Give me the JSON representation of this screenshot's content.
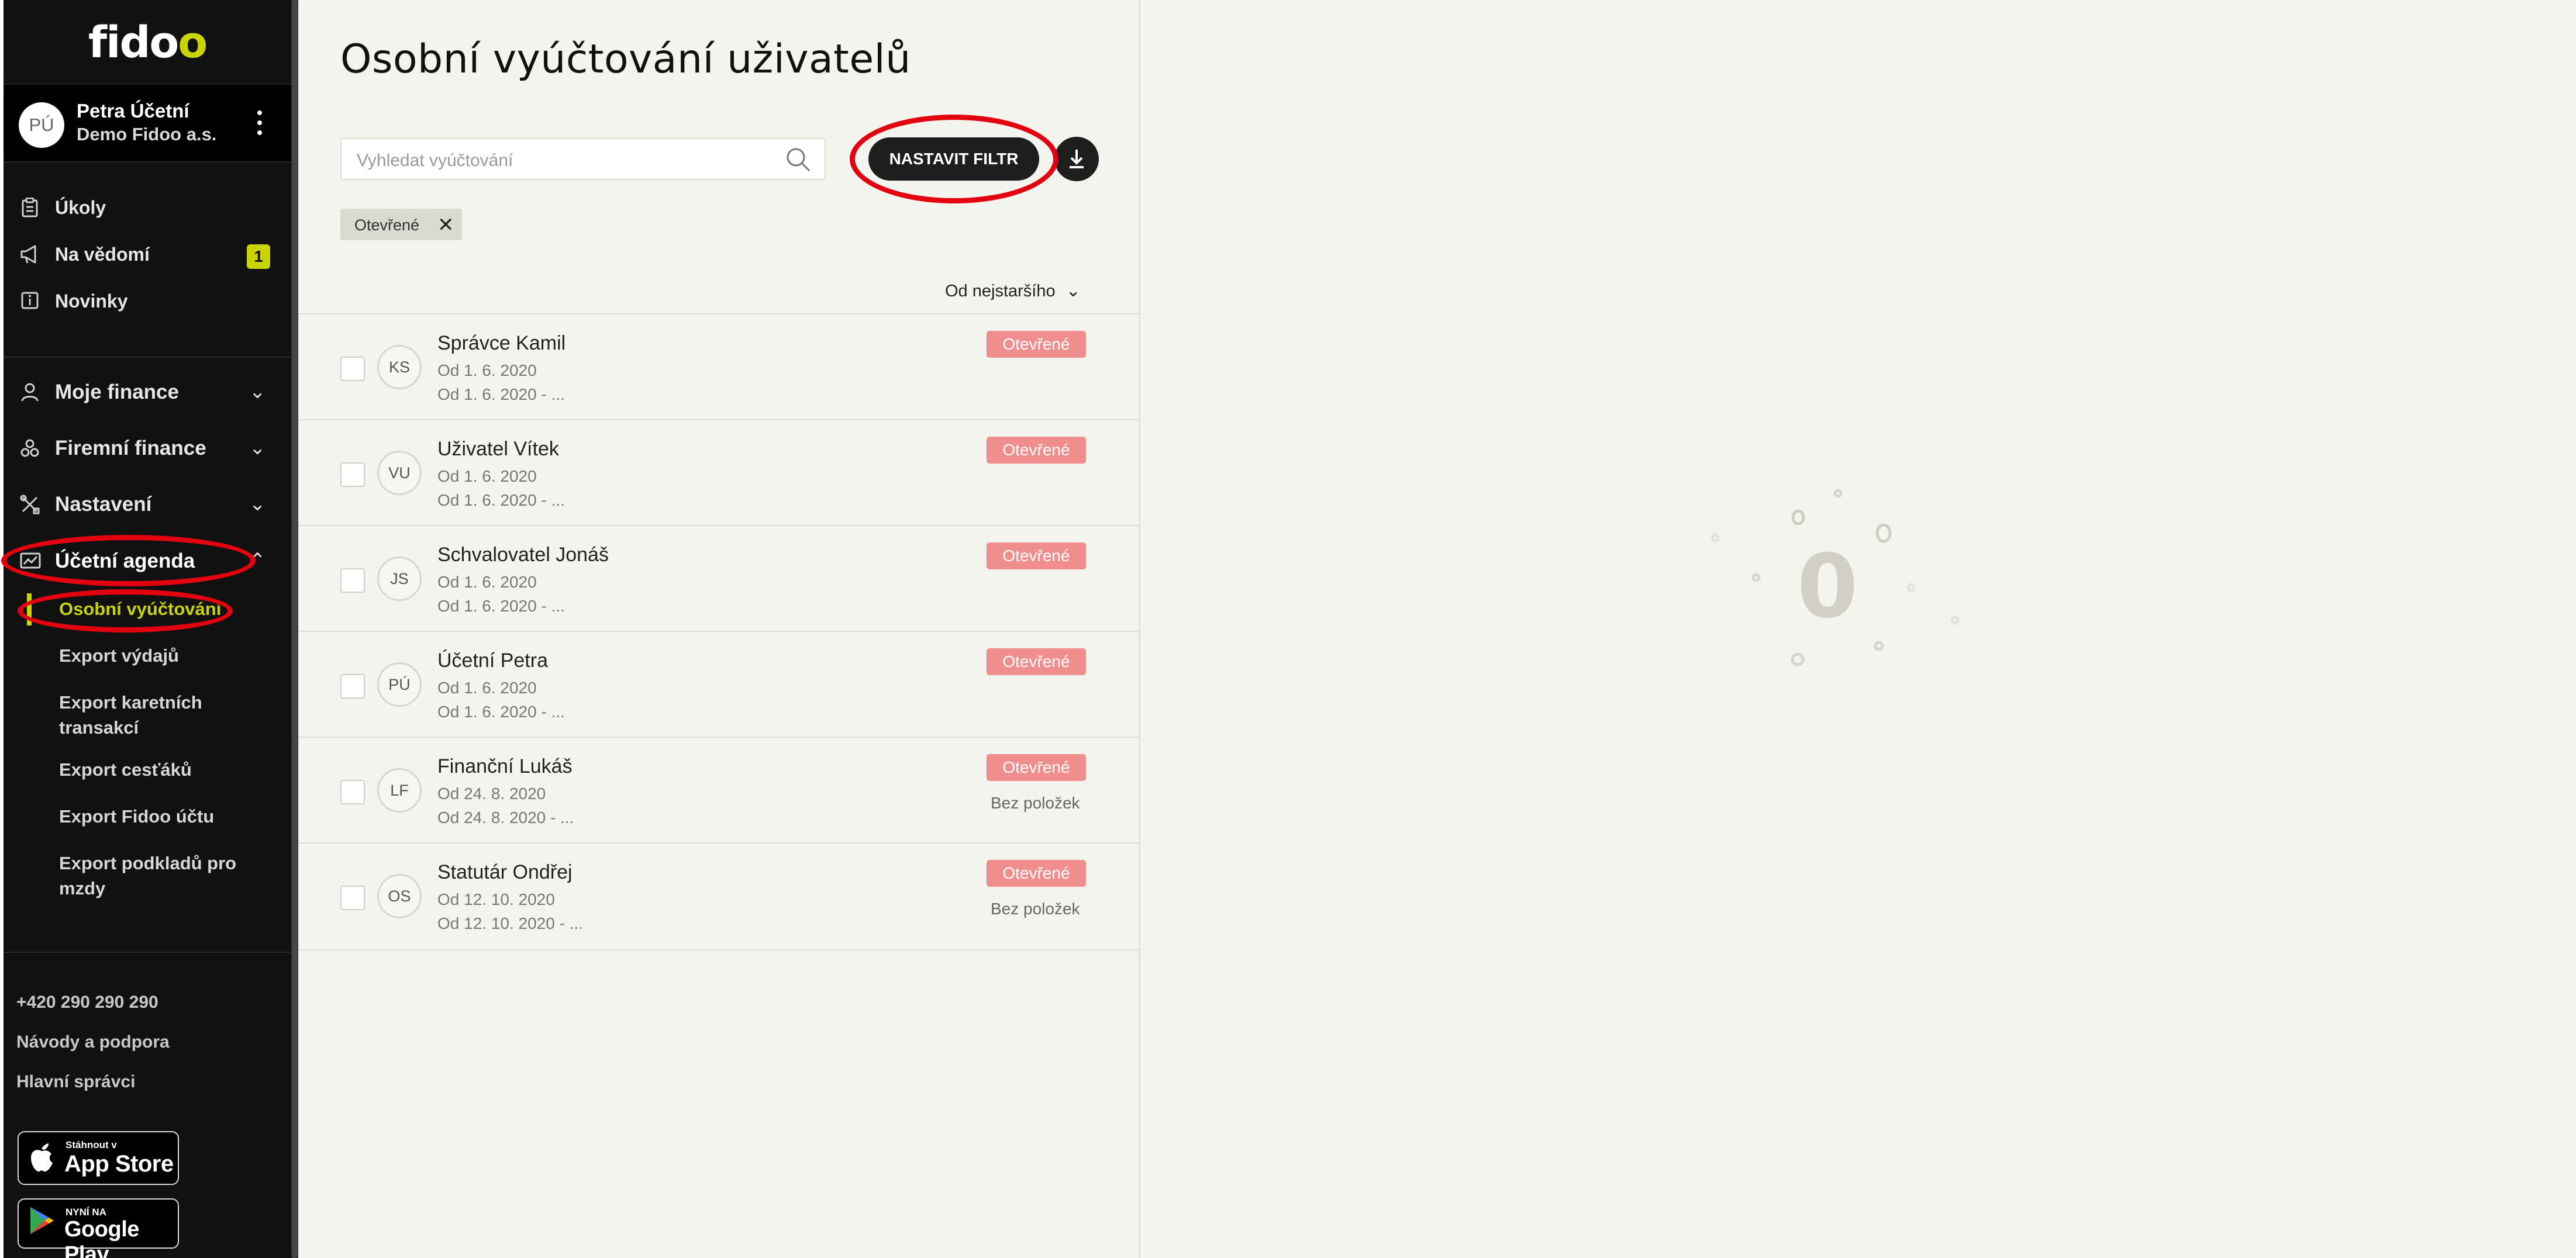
{
  "app": {
    "logo_text": "fido",
    "logo_hl": "o"
  },
  "user": {
    "initials": "PÚ",
    "name": "Petra Účetní",
    "company": "Demo Fidoo a.s."
  },
  "nav": {
    "top": [
      {
        "label": "Úkoly",
        "icon": "clipboard-icon"
      },
      {
        "label": "Na vědomí",
        "icon": "megaphone-icon",
        "badge": "1"
      },
      {
        "label": "Novinky",
        "icon": "info-icon"
      }
    ],
    "sections": [
      {
        "label": "Moje finance",
        "icon": "user-icon"
      },
      {
        "label": "Firemní finance",
        "icon": "coins-icon"
      },
      {
        "label": "Nastavení",
        "icon": "tools-icon"
      },
      {
        "label": "Účetní agenda",
        "icon": "chart-icon"
      }
    ],
    "sub": [
      "Osobní vyúčtování",
      "Export výdajů",
      "Export karetních transakcí",
      "Export cesťáků",
      "Export Fidoo účtu",
      "Export podkladů pro mzdy"
    ]
  },
  "footer": {
    "phone": "+420 290 290 290",
    "help": "Návody a podpora",
    "admins": "Hlavní správci",
    "appstore_small": "Stáhnout v",
    "appstore_big": "App Store",
    "gplay_small": "NYNÍ NA",
    "gplay_big": "Google Play"
  },
  "main": {
    "title": "Osobní vyúčtování uživatelů",
    "search_placeholder": "Vyhledat vyúčtování",
    "filter_button": "NASTAVIT FILTR",
    "chip": "Otevřené",
    "sort": "Od nejstaršího"
  },
  "rows": [
    {
      "initials": "KS",
      "name": "Správce Kamil",
      "d1": "Od 1. 6. 2020",
      "d2": "Od 1. 6. 2020 - ...",
      "status": "Otevřené",
      "note": ""
    },
    {
      "initials": "VU",
      "name": "Uživatel Vítek",
      "d1": "Od 1. 6. 2020",
      "d2": "Od 1. 6. 2020 - ...",
      "status": "Otevřené",
      "note": ""
    },
    {
      "initials": "JS",
      "name": "Schvalovatel Jonáš",
      "d1": "Od 1. 6. 2020",
      "d2": "Od 1. 6. 2020 - ...",
      "status": "Otevřené",
      "note": ""
    },
    {
      "initials": "PÚ",
      "name": "Účetní Petra",
      "d1": "Od 1. 6. 2020",
      "d2": "Od 1. 6. 2020 - ...",
      "status": "Otevřené",
      "note": ""
    },
    {
      "initials": "LF",
      "name": "Finanční Lukáš",
      "d1": "Od 24. 8. 2020",
      "d2": "Od 24. 8. 2020 - ...",
      "status": "Otevřené",
      "note": "Bez položek"
    },
    {
      "initials": "OS",
      "name": "Statutár Ondřej",
      "d1": "Od 12. 10. 2020",
      "d2": "Od 12. 10. 2020 - ...",
      "status": "Otevřené",
      "note": "Bez položek"
    }
  ],
  "detail": {
    "loader_glyph": "0"
  },
  "colors": {
    "accent": "#c9d400",
    "status_open": "#f08e8e",
    "sidebar_bg": "#111111",
    "panel_bg": "#f4f4ef",
    "annotation": "#e3000f"
  }
}
